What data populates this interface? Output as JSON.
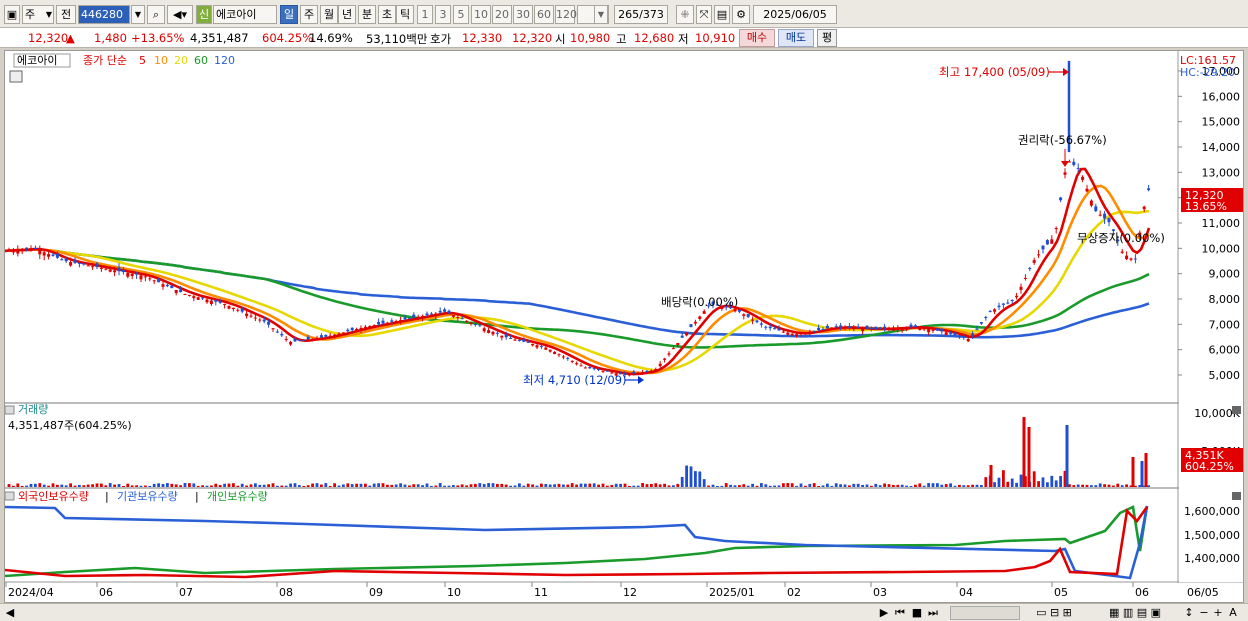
{
  "toolbar": {
    "type_select": "주",
    "prev_label": "전",
    "code": "446280",
    "stock_badge": "신",
    "stock_name": "에코아이",
    "periods": [
      "일",
      "주",
      "월",
      "년",
      "분",
      "초",
      "틱"
    ],
    "minute_options": [
      "1",
      "3",
      "5",
      "10",
      "20",
      "30",
      "60",
      "120"
    ],
    "page_current": "265",
    "page_total": "/373",
    "date": "2025/06/05"
  },
  "info": {
    "price": "12,320",
    "arrow": "▲",
    "change": "1,480",
    "change_pct": "+13.65%",
    "volume": "4,351,487",
    "volume_pct": "604.25%",
    "turnover": "14.69%",
    "amount": "53,110백만",
    "quote_label": "호가",
    "ask": "12,330",
    "bid": "12,320",
    "open_label": "시",
    "open": "10,980",
    "high_label": "고",
    "high": "12,680",
    "low_label": "저",
    "low": "10,910",
    "buy_label": "매수",
    "sell_label": "매도",
    "eval_label": "평"
  },
  "price_panel": {
    "name": "에코아이",
    "ma_label": "종가 단순",
    "ma_periods": [
      "5",
      "10",
      "20",
      "60",
      "120"
    ],
    "ma_colors": [
      "#e00000",
      "#ff8c00",
      "#e6d800",
      "#1a9a2a",
      "#2a5fd6"
    ],
    "lc": "LC:161.57",
    "hc": "HC:-29.20",
    "high_note": "최고 17,400 (05/09)",
    "low_note": "최저 4,710 (12/09)",
    "event_rights": "권리락(-56.67%)",
    "event_dividend": "배당락(0.00%)",
    "event_bonus": "무상증자(0.00%)",
    "current_price": "12,320",
    "current_pct": "13.65%",
    "y_ticks": [
      "17,000",
      "16,000",
      "15,000",
      "14,000",
      "13,000",
      "12,000",
      "11,000",
      "10,000",
      "9,000",
      "8,000",
      "7,000",
      "6,000",
      "5,000"
    ]
  },
  "volume_panel": {
    "title": "거래량",
    "value": "4,351,487주(604.25%)",
    "y_ticks": [
      "10,000K",
      "5,000K"
    ],
    "current": "4,351K",
    "current_pct": "604.25%"
  },
  "holder_panel": {
    "legend": [
      "외국인보유수량",
      "기관보유수량",
      "개인보유수량"
    ],
    "colors": [
      "#e00000",
      "#2a5fd6",
      "#1a9a2a"
    ],
    "y_ticks": [
      "1,600,000",
      "1,500,000",
      "1,400,000"
    ]
  },
  "x_axis": [
    "2024/04",
    "06",
    "07",
    "08",
    "09",
    "10",
    "11",
    "12",
    "2025/01",
    "02",
    "03",
    "04",
    "05",
    "06",
    "06/05"
  ]
}
